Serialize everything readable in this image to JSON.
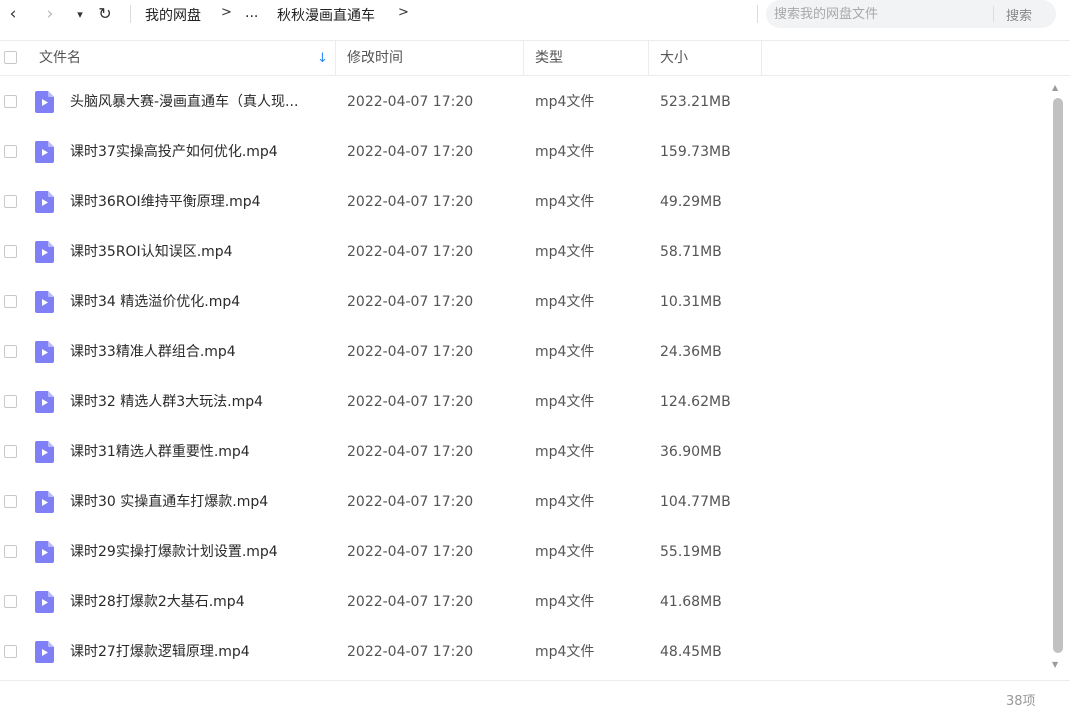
{
  "nav": {
    "back_icon": "‹",
    "forward_icon": "›",
    "dropdown_icon": "▾",
    "refresh_icon": "↻"
  },
  "breadcrumb": {
    "root": "我的网盘",
    "sep1": ">",
    "ellipsis": "...",
    "current": "秋秋漫画直通车",
    "sep2": ">"
  },
  "search": {
    "placeholder": "搜索我的网盘文件",
    "value": "",
    "button_label": "搜索"
  },
  "columns": {
    "name": "文件名",
    "modified": "修改时间",
    "type": "类型",
    "size": "大小",
    "sort_icon": "↓"
  },
  "files": [
    {
      "name": "头脑风暴大赛-漫画直通车（真人现...",
      "modified": "2022-04-07 17:20",
      "type": "mp4文件",
      "size": "523.21MB"
    },
    {
      "name": "课时37实操高投产如何优化.mp4",
      "modified": "2022-04-07 17:20",
      "type": "mp4文件",
      "size": "159.73MB"
    },
    {
      "name": "课时36ROI维持平衡原理.mp4",
      "modified": "2022-04-07 17:20",
      "type": "mp4文件",
      "size": "49.29MB"
    },
    {
      "name": "课时35ROI认知误区.mp4",
      "modified": "2022-04-07 17:20",
      "type": "mp4文件",
      "size": "58.71MB"
    },
    {
      "name": "课时34 精选溢价优化.mp4",
      "modified": "2022-04-07 17:20",
      "type": "mp4文件",
      "size": "10.31MB"
    },
    {
      "name": "课时33精准人群组合.mp4",
      "modified": "2022-04-07 17:20",
      "type": "mp4文件",
      "size": "24.36MB"
    },
    {
      "name": "课时32 精选人群3大玩法.mp4",
      "modified": "2022-04-07 17:20",
      "type": "mp4文件",
      "size": "124.62MB"
    },
    {
      "name": "课时31精选人群重要性.mp4",
      "modified": "2022-04-07 17:20",
      "type": "mp4文件",
      "size": "36.90MB"
    },
    {
      "name": "课时30 实操直通车打爆款.mp4",
      "modified": "2022-04-07 17:20",
      "type": "mp4文件",
      "size": "104.77MB"
    },
    {
      "name": "课时29实操打爆款计划设置.mp4",
      "modified": "2022-04-07 17:20",
      "type": "mp4文件",
      "size": "55.19MB"
    },
    {
      "name": "课时28打爆款2大基石.mp4",
      "modified": "2022-04-07 17:20",
      "type": "mp4文件",
      "size": "41.68MB"
    },
    {
      "name": "课时27打爆款逻辑原理.mp4",
      "modified": "2022-04-07 17:20",
      "type": "mp4文件",
      "size": "48.45MB"
    }
  ],
  "footer": {
    "count": "38项"
  },
  "colors": {
    "file_icon": "#7f80f5",
    "sort_arrow": "#2f8cf3",
    "search_bg": "#f2f3f5"
  },
  "scroll": {
    "up_icon": "▲",
    "down_icon": "▼"
  }
}
